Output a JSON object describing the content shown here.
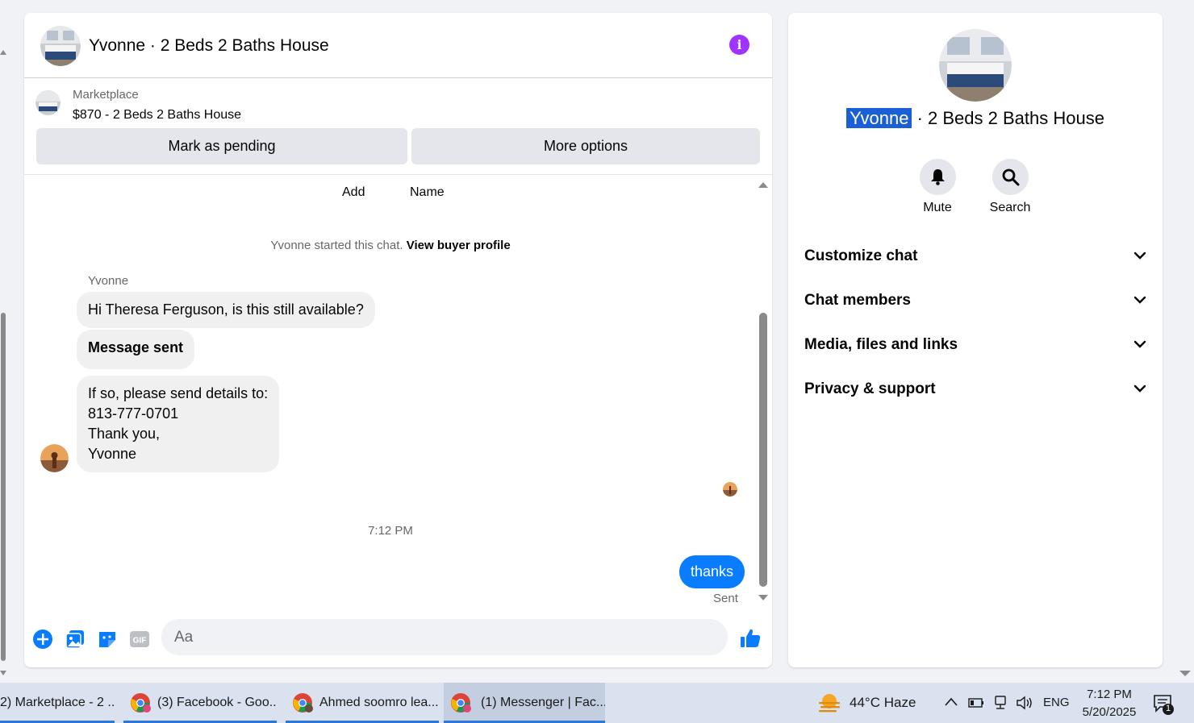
{
  "chat": {
    "title": "Yvonne · 2 Beds 2 Baths House",
    "listing": {
      "source": "Marketplace",
      "price_title": "$870 - 2 Beds 2 Baths House",
      "mark_pending": "Mark as pending",
      "more_options": "More options"
    },
    "toolbar_links": {
      "add": "Add",
      "name": "Name"
    },
    "started_text": "Yvonne started this chat.",
    "view_buyer_profile": "View buyer profile",
    "sender_name": "Yvonne",
    "messages": [
      "Hi Theresa Ferguson, is this still available?",
      "Message sent",
      "If so, please send details to:",
      "813-777-0701",
      "Thank you,",
      "Yvonne"
    ],
    "timestamp": "7:12 PM",
    "outgoing": "thanks",
    "status": "Sent",
    "composer_placeholder": "Aa"
  },
  "side": {
    "name_highlight": "Yvonne",
    "name_rest": " · 2 Beds 2 Baths House",
    "mute": "Mute",
    "search": "Search",
    "sections": [
      "Customize chat",
      "Chat members",
      "Media, files and links",
      "Privacy & support"
    ]
  },
  "taskbar": {
    "tasks": [
      "2) Marketplace - 2 ...",
      "(3) Facebook - Goo...",
      "Ahmed soomro lea...",
      "(1) Messenger | Fac..."
    ],
    "weather": "44°C  Haze",
    "lang": "ENG",
    "time": "7:12 PM",
    "date": "5/20/2025",
    "notif_count": "1"
  },
  "colors": {
    "accent": "#0a7cff",
    "info": "#a033ff",
    "highlight": "#1a5fd6"
  }
}
